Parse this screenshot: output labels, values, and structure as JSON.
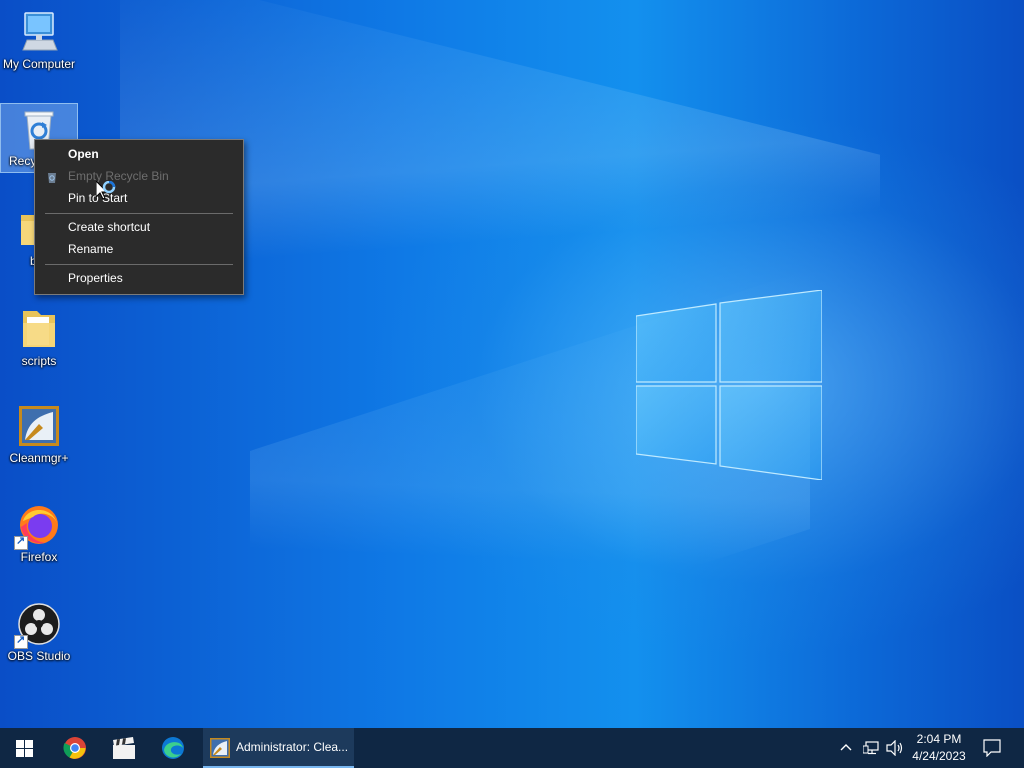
{
  "desktop": {
    "icons": [
      {
        "label": "My Computer",
        "icon": "computer-icon"
      },
      {
        "label": "Recyc",
        "icon": "recycle-bin-icon"
      },
      {
        "label": "b",
        "icon": "folder-icon"
      },
      {
        "label": "scripts",
        "icon": "folder-icon"
      },
      {
        "label": "Cleanmgr+",
        "icon": "cleanmgr-icon"
      },
      {
        "label": "Firefox",
        "icon": "firefox-icon"
      },
      {
        "label": "OBS Studio",
        "icon": "obs-icon"
      }
    ]
  },
  "context_menu": {
    "items": [
      {
        "label": "Open",
        "state": "default"
      },
      {
        "label": "Empty Recycle Bin",
        "state": "disabled"
      },
      {
        "label": "Pin to Start",
        "state": "normal"
      },
      {
        "label": "Create shortcut",
        "state": "normal"
      },
      {
        "label": "Rename",
        "state": "normal"
      },
      {
        "label": "Properties",
        "state": "normal"
      }
    ]
  },
  "taskbar": {
    "start": "windows-start-icon",
    "pinned": [
      "chrome-icon",
      "clapperboard-icon",
      "edge-icon"
    ],
    "active_app": {
      "label": "Administrator: Clea...",
      "icon": "cleanmgr-icon"
    },
    "clock": {
      "time": "2:04 PM",
      "date": "4/24/2023"
    },
    "tray": [
      "chevron-up-icon",
      "network-icon",
      "volume-icon",
      "notification-icon"
    ]
  },
  "colors": {
    "taskbar_bg": "#0f2744",
    "menu_bg": "#2b2b2b",
    "accent": "#78b6f0"
  }
}
